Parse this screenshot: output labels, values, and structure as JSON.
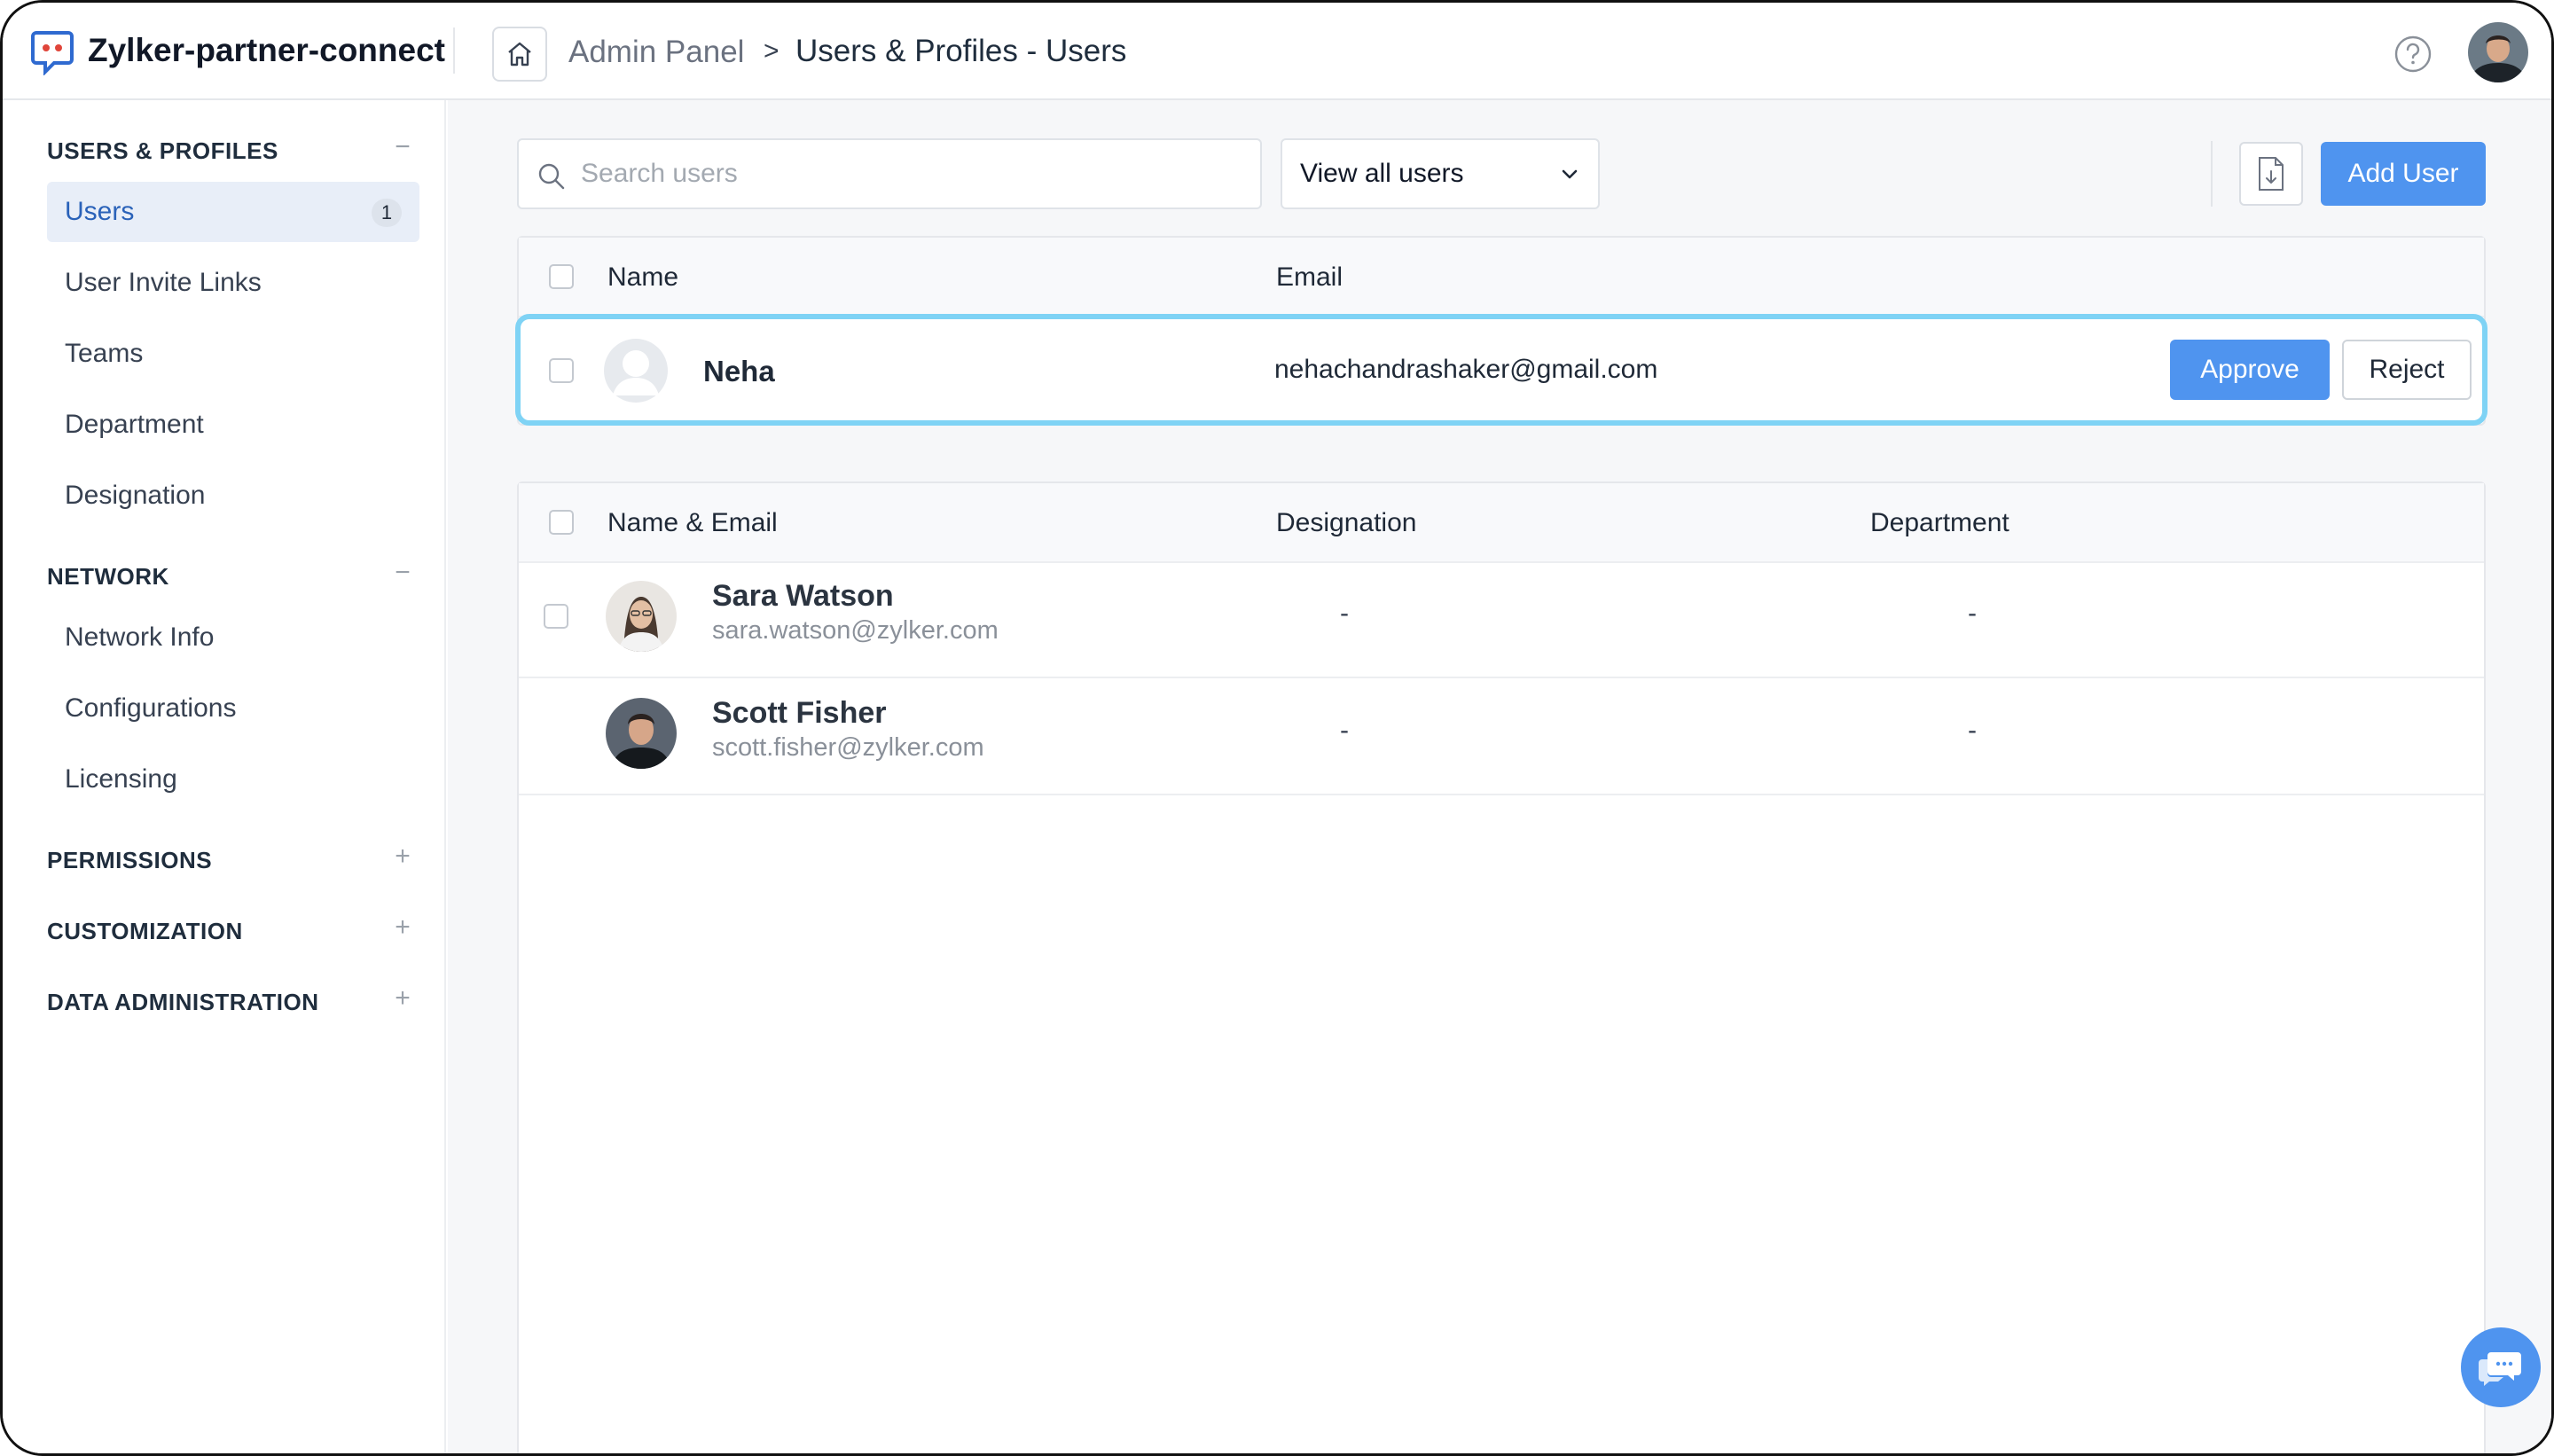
{
  "header": {
    "app_title": "Zylker-partner-connect",
    "breadcrumb": {
      "root": "Admin Panel",
      "separator": ">",
      "current": "Users & Profiles - Users"
    }
  },
  "sidebar": {
    "sections": [
      {
        "title": "USERS & PROFILES",
        "toggle": "−",
        "items": [
          {
            "label": "Users",
            "count": "1"
          },
          {
            "label": "User Invite Links"
          },
          {
            "label": "Teams"
          },
          {
            "label": "Department"
          },
          {
            "label": "Designation"
          }
        ]
      },
      {
        "title": "NETWORK",
        "toggle": "−",
        "items": [
          {
            "label": "Network Info"
          },
          {
            "label": "Configurations"
          },
          {
            "label": "Licensing"
          }
        ]
      },
      {
        "title": "PERMISSIONS",
        "toggle": "+"
      },
      {
        "title": "CUSTOMIZATION",
        "toggle": "+"
      },
      {
        "title": "DATA ADMINISTRATION",
        "toggle": "+"
      }
    ]
  },
  "toolbar": {
    "search_placeholder": "Search users",
    "view_filter": "View all users",
    "add_user_label": "Add User"
  },
  "pending": {
    "columns": [
      "Name",
      "Email"
    ],
    "rows": [
      {
        "name": "Neha",
        "email": "nehachandrashaker@gmail.com",
        "approve_label": "Approve",
        "reject_label": "Reject"
      }
    ]
  },
  "users": {
    "columns": [
      "Name & Email",
      "Designation",
      "Department"
    ],
    "rows": [
      {
        "name": "Sara Watson",
        "email": "sara.watson@zylker.com",
        "designation": "-",
        "department": "-"
      },
      {
        "name": "Scott Fisher",
        "email": "scott.fisher@zylker.com",
        "designation": "-",
        "department": "-"
      }
    ]
  },
  "colors": {
    "primary": "#4f94ef",
    "highlight_border": "#7fd3f5",
    "active_nav_bg": "#e8eef8",
    "active_nav_text": "#2a62b9"
  }
}
